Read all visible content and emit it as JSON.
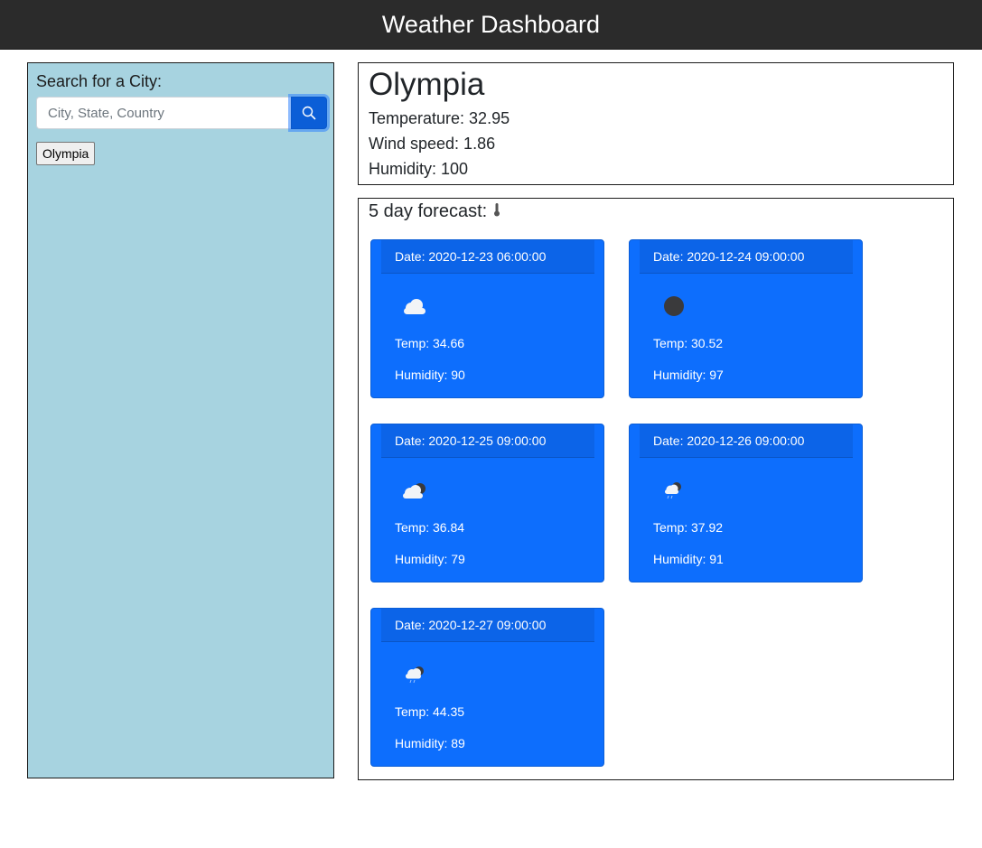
{
  "header": {
    "title": "Weather Dashboard"
  },
  "sidebar": {
    "label": "Search for a City:",
    "search_placeholder": "City, State, Country",
    "search_value": "",
    "history": [
      "Olympia"
    ]
  },
  "current": {
    "city": "Olympia",
    "temperature": "Temperature: 32.95",
    "wind": "Wind speed: 1.86",
    "humidity": "Humidity: 100"
  },
  "forecast": {
    "title": "5 day forecast:",
    "title_icon": "thermometer-icon",
    "days": [
      {
        "date": "Date: 2020-12-23 06:00:00",
        "icon": "cloud-icon",
        "temp": "Temp: 34.66",
        "humidity": "Humidity: 90"
      },
      {
        "date": "Date: 2020-12-24 09:00:00",
        "icon": "dark-cloud-icon",
        "temp": "Temp: 30.52",
        "humidity": "Humidity: 97"
      },
      {
        "date": "Date: 2020-12-25 09:00:00",
        "icon": "broken-clouds-icon",
        "temp": "Temp: 36.84",
        "humidity": "Humidity: 79"
      },
      {
        "date": "Date: 2020-12-26 09:00:00",
        "icon": "rain-cloud-icon",
        "temp": "Temp: 37.92",
        "humidity": "Humidity: 91"
      },
      {
        "date": "Date: 2020-12-27 09:00:00",
        "icon": "rain-cloud-icon",
        "temp": "Temp: 44.35",
        "humidity": "Humidity: 89"
      }
    ]
  },
  "colors": {
    "header_bg": "#2b2b2b",
    "sidebar_bg": "#a7d3e0",
    "card_bg": "#0d6efd",
    "button_bg": "#0b5ed7"
  }
}
